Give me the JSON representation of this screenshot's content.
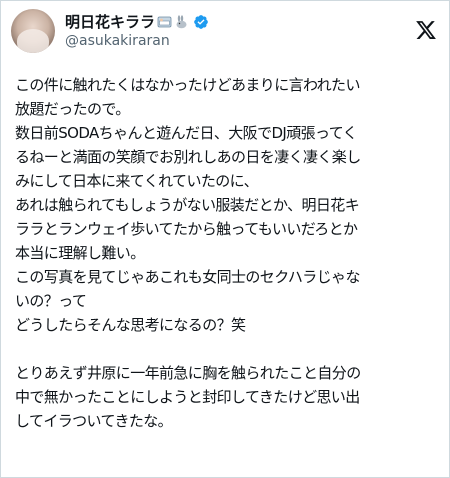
{
  "profile": {
    "display_name": "明日花キララ",
    "handle": "@asukakiraran",
    "emoji_icons": [
      "hotel-bed-emoji",
      "rabbit-emoji"
    ],
    "verified": true
  },
  "tweet": {
    "lines": [
      "この件に触れたくはなかったけどあまりに言われたい",
      "放題だったので。",
      "数日前SODAちゃんと遊んだ日、大阪でDJ頑張ってく",
      "るねーと満面の笑顔でお別れしあの日を凄く凄く楽し",
      "みにして日本に来てくれていたのに、",
      "あれは触られてもしょうがない服装だとか、明日花キ",
      "ララとランウェイ歩いてたから触ってもいいだろとか",
      "本当に理解し難い。",
      "この写真を見てじゃあこれも女同士のセクハラじゃな",
      "いの？って",
      "どうしたらそんな思考になるの？笑",
      "",
      "とりあえず井原に一年前急に胸を触られたこと自分の",
      "中で無かったことにしようと封印してきたけど思い出",
      "してイラついてきたな。"
    ]
  },
  "colors": {
    "text": "#0f1419",
    "secondary": "#536471",
    "verified_blue": "#1d9bf0",
    "border": "#cfd9de"
  }
}
